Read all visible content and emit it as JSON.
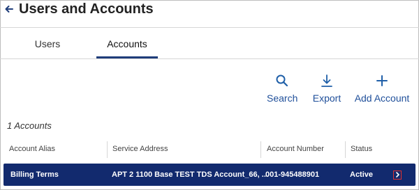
{
  "header": {
    "title": "Users and Accounts",
    "back_icon": "back-arrow-icon"
  },
  "tabs": [
    {
      "label": "Users",
      "active": false
    },
    {
      "label": "Accounts",
      "active": true
    }
  ],
  "actions": {
    "search": {
      "label": "Search",
      "icon": "search-icon"
    },
    "export": {
      "label": "Export",
      "icon": "download-icon"
    },
    "add": {
      "label": "Add Account",
      "icon": "plus-icon"
    }
  },
  "count_text": "1 Accounts",
  "table": {
    "columns": [
      "Account Alias",
      "Service Address",
      "Account Number",
      "Status"
    ],
    "rows": [
      {
        "alias": "Billing Terms",
        "service_address": "APT 2 1100 Base TEST TDS Account_66, ...",
        "account_number": "001-945488901",
        "status": "Active"
      }
    ]
  },
  "colors": {
    "accent": "#1f3d7a",
    "row_bg": "#122a6e",
    "link": "#1f5fa8",
    "highlight_box": "#e0312f"
  }
}
